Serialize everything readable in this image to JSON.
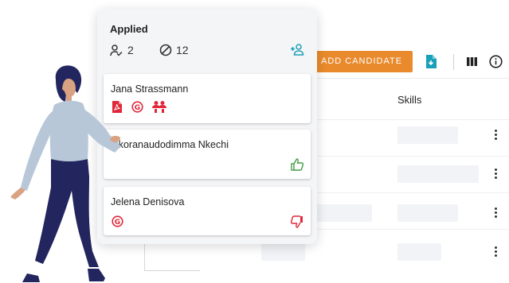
{
  "table": {
    "skills_header": "Skills"
  },
  "toolbar": {
    "add_candidate_label": "ADD CANDIDATE",
    "icons": [
      "export-file-icon",
      "columns-icon",
      "info-icon"
    ]
  },
  "column": {
    "title": "Applied",
    "assigned_count": "2",
    "rejected_count": "12",
    "cards": [
      {
        "name": "Jana Strassmann",
        "icons": [
          "pdf-file-icon",
          "g-badge-icon",
          "group-icon"
        ]
      },
      {
        "name": "Okoranaudodimma Nkechi",
        "icons": [
          "thumbs-up-icon"
        ]
      },
      {
        "name": "Jelena Denisova",
        "icons": [
          "g-badge-icon",
          "thumbs-down-icon"
        ]
      }
    ]
  },
  "colors": {
    "accent_orange": "#e98a2c",
    "accent_teal": "#1aa0b8",
    "alert_red": "#e0283a",
    "positive_green": "#43a047",
    "figure_navy": "#23265e",
    "figure_sweater": "#b8c7d8"
  }
}
